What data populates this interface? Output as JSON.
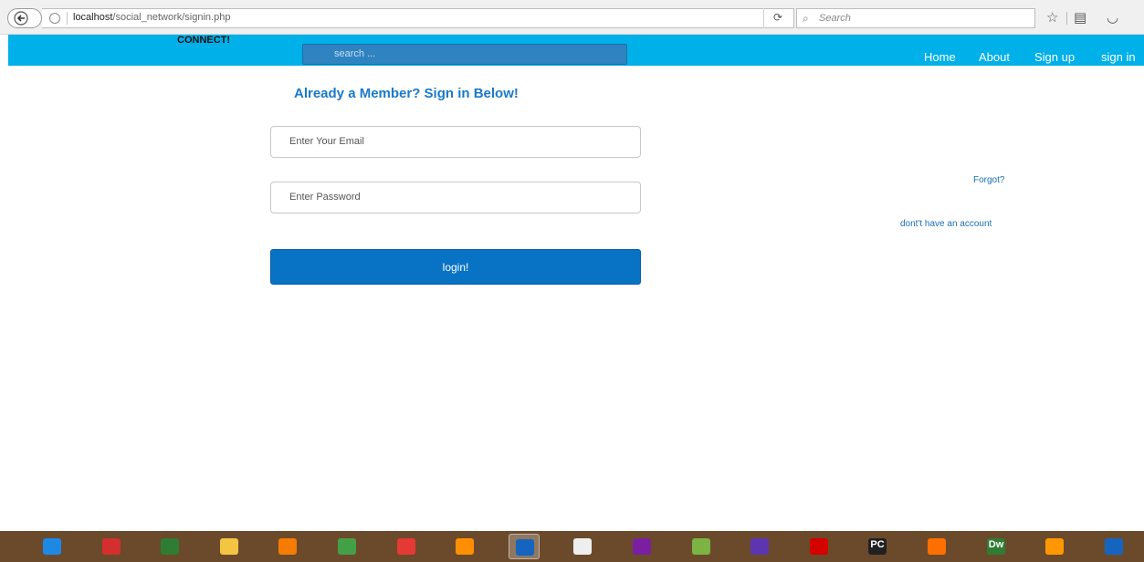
{
  "browser": {
    "url_host": "localhost",
    "url_path": "/social_network/signin.php",
    "search_placeholder": "Search"
  },
  "site": {
    "brand": "CONNECT!",
    "search_placeholder": "search ...",
    "nav": [
      "Home",
      "About",
      "Sign up",
      "sign in"
    ]
  },
  "signin": {
    "heading": "Already a Member? Sign in Below!",
    "email_placeholder": "Enter Your Email",
    "password_placeholder": "Enter Password",
    "login_label": "login!",
    "forgot_link": "Forgot?",
    "no_account_link": "dont't have an account"
  },
  "colors": {
    "navbar": "#00b0e8",
    "heading": "#1a79c9",
    "button": "#0872c5",
    "taskbar": "#6b4a2b"
  },
  "taskbar": {
    "icons": [
      {
        "name": "internet-explorer-icon",
        "label": "",
        "color": "#1e88e5"
      },
      {
        "name": "toolbox-icon",
        "label": "",
        "color": "#d32f2f"
      },
      {
        "name": "android-studio-icon",
        "label": "",
        "color": "#2e7d32"
      },
      {
        "name": "file-explorer-icon",
        "label": "",
        "color": "#f4c542"
      },
      {
        "name": "xampp-icon",
        "label": "",
        "color": "#f57c00"
      },
      {
        "name": "task-manager-icon",
        "label": "",
        "color": "#43a047"
      },
      {
        "name": "chrome-icon",
        "label": "",
        "color": "#e53935"
      },
      {
        "name": "uc-browser-icon",
        "label": "",
        "color": "#ff8f00"
      },
      {
        "name": "firefox-icon",
        "label": "",
        "color": "#1565c0"
      },
      {
        "name": "pen-tool-icon",
        "label": "",
        "color": "#eeeeee"
      },
      {
        "name": "visual-studio-icon",
        "label": "",
        "color": "#7b1fa2"
      },
      {
        "name": "android-icon",
        "label": "",
        "color": "#7cb342"
      },
      {
        "name": "visual-studio-2-icon",
        "label": "",
        "color": "#5e35b1"
      },
      {
        "name": "opera-icon",
        "label": "",
        "color": "#d50000"
      },
      {
        "name": "pycharm-icon",
        "label": "PC",
        "color": "#212121"
      },
      {
        "name": "sublime-text-icon",
        "label": "",
        "color": "#ff6f00"
      },
      {
        "name": "dreamweaver-icon",
        "label": "Dw",
        "color": "#2e7d32"
      },
      {
        "name": "vlc-icon",
        "label": "",
        "color": "#ff9800"
      },
      {
        "name": "word-icon",
        "label": "",
        "color": "#1565c0"
      }
    ]
  }
}
